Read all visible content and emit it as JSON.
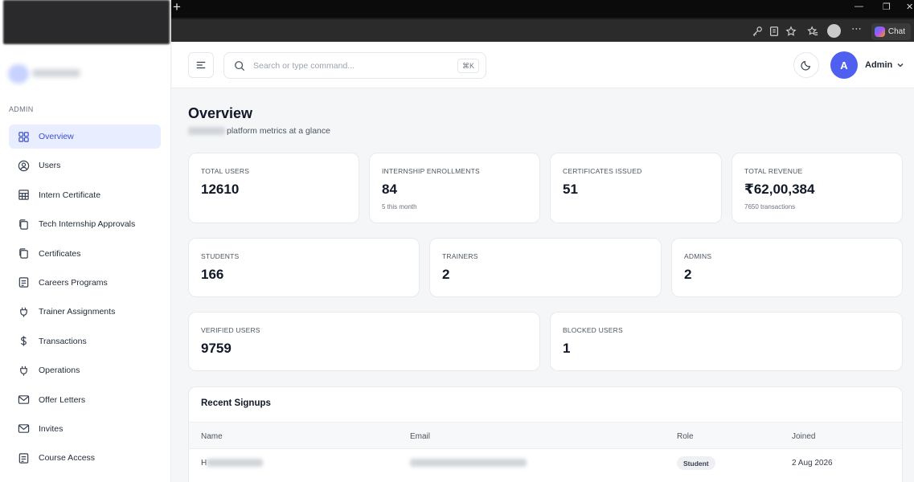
{
  "browser": {
    "new_tab": "+",
    "chat_label": "Chat"
  },
  "sidebar": {
    "section_label": "ADMIN",
    "items": [
      {
        "label": "Overview",
        "icon": "grid-icon",
        "active": true
      },
      {
        "label": "Users",
        "icon": "user-circle-icon"
      },
      {
        "label": "Intern Certificate",
        "icon": "table-icon"
      },
      {
        "label": "Tech Internship Approvals",
        "icon": "copy-icon"
      },
      {
        "label": "Certificates",
        "icon": "copy-icon"
      },
      {
        "label": "Careers Programs",
        "icon": "document-icon"
      },
      {
        "label": "Trainer Assignments",
        "icon": "plug-icon"
      },
      {
        "label": "Transactions",
        "icon": "dollar-icon"
      },
      {
        "label": "Operations",
        "icon": "plug-icon"
      },
      {
        "label": "Offer Letters",
        "icon": "mail-icon"
      },
      {
        "label": "Invites",
        "icon": "mail-icon"
      },
      {
        "label": "Course Access",
        "icon": "document-icon"
      }
    ]
  },
  "header": {
    "search_placeholder": "Search or type command...",
    "shortcut": "⌘K",
    "avatar_initial": "A",
    "user_name": "Admin"
  },
  "main": {
    "title": "Overview",
    "subtitle": "platform metrics at a glance",
    "stats_row1": [
      {
        "label": "TOTAL USERS",
        "value": "12610",
        "note": ""
      },
      {
        "label": "INTERNSHIP ENROLLMENTS",
        "value": "84",
        "note": "5 this month"
      },
      {
        "label": "CERTIFICATES ISSUED",
        "value": "51",
        "note": ""
      },
      {
        "label": "TOTAL REVENUE",
        "value": "₹62,00,384",
        "note": "7650 transactions"
      }
    ],
    "stats_row2": [
      {
        "label": "STUDENTS",
        "value": "166"
      },
      {
        "label": "TRAINERS",
        "value": "2"
      },
      {
        "label": "ADMINS",
        "value": "2"
      }
    ],
    "stats_row3": [
      {
        "label": "VERIFIED USERS",
        "value": "9759"
      },
      {
        "label": "BLOCKED USERS",
        "value": "1"
      }
    ],
    "recent_signups": {
      "title": "Recent Signups",
      "columns": [
        "Name",
        "Email",
        "Role",
        "Joined"
      ],
      "rows": [
        {
          "name_initial": "H",
          "role": "Student",
          "joined": "2 Aug 2026"
        }
      ]
    }
  }
}
